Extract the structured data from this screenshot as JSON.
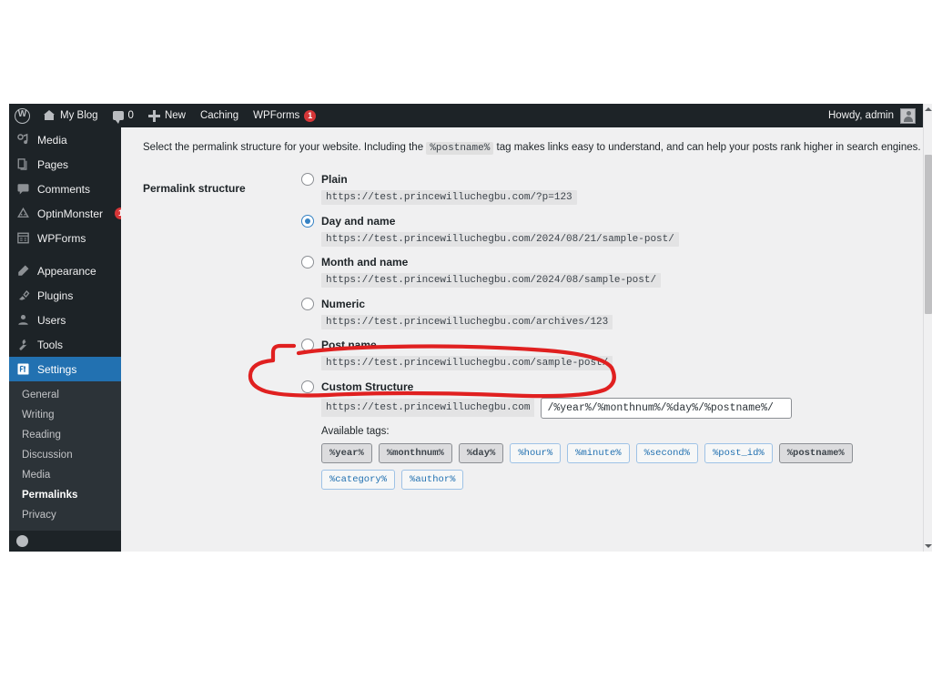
{
  "adminbar": {
    "wp_logo": "wordpress-logo",
    "site_name": "My Blog",
    "comments_count": "0",
    "new_label": "New",
    "caching_label": "Caching",
    "wpforms_label": "WPForms",
    "wpforms_badge": "1",
    "howdy": "Howdy, admin"
  },
  "sidebar": {
    "items": [
      {
        "label": "Media",
        "icon": "media-icon",
        "badge": ""
      },
      {
        "label": "Pages",
        "icon": "pages-icon",
        "badge": ""
      },
      {
        "label": "Comments",
        "icon": "comments-icon",
        "badge": ""
      },
      {
        "label": "OptinMonster",
        "icon": "optinmonster-icon",
        "badge": "1"
      },
      {
        "label": "WPForms",
        "icon": "wpforms-icon",
        "badge": ""
      },
      {
        "label": "Appearance",
        "icon": "appearance-icon",
        "badge": ""
      },
      {
        "label": "Plugins",
        "icon": "plugins-icon",
        "badge": ""
      },
      {
        "label": "Users",
        "icon": "users-icon",
        "badge": ""
      },
      {
        "label": "Tools",
        "icon": "tools-icon",
        "badge": ""
      },
      {
        "label": "Settings",
        "icon": "settings-icon",
        "badge": ""
      }
    ],
    "submenu": [
      {
        "label": "General"
      },
      {
        "label": "Writing"
      },
      {
        "label": "Reading"
      },
      {
        "label": "Discussion"
      },
      {
        "label": "Media"
      },
      {
        "label": "Permalinks"
      },
      {
        "label": "Privacy"
      }
    ],
    "active_item": "Settings",
    "active_subitem": "Permalinks"
  },
  "main": {
    "intro_before": "Select the permalink structure for your website. Including the",
    "intro_tag": "%postname%",
    "intro_after": "tag makes links easy to understand, and can help your posts rank higher in search engines.",
    "row_label": "Permalink structure",
    "options": [
      {
        "label": "Plain",
        "example": "https://test.princewilluchegbu.com/?p=123",
        "selected": false
      },
      {
        "label": "Day and name",
        "example": "https://test.princewilluchegbu.com/2024/08/21/sample-post/",
        "selected": true
      },
      {
        "label": "Month and name",
        "example": "https://test.princewilluchegbu.com/2024/08/sample-post/",
        "selected": false
      },
      {
        "label": "Numeric",
        "example": "https://test.princewilluchegbu.com/archives/123",
        "selected": false
      },
      {
        "label": "Post name",
        "example": "https://test.princewilluchegbu.com/sample-post/",
        "selected": false
      }
    ],
    "custom": {
      "label": "Custom Structure",
      "selected": false,
      "prefix": "https://test.princewilluchegbu.com",
      "value": "/%year%/%monthnum%/%day%/%postname%/"
    },
    "available_tags_label": "Available tags:",
    "tags": [
      {
        "label": "%year%",
        "used": true
      },
      {
        "label": "%monthnum%",
        "used": true
      },
      {
        "label": "%day%",
        "used": true
      },
      {
        "label": "%hour%",
        "used": false
      },
      {
        "label": "%minute%",
        "used": false
      },
      {
        "label": "%second%",
        "used": false
      },
      {
        "label": "%post_id%",
        "used": false
      },
      {
        "label": "%postname%",
        "used": true
      },
      {
        "label": "%category%",
        "used": false
      },
      {
        "label": "%author%",
        "used": false
      }
    ]
  },
  "annotation": {
    "shape": "hand-drawn-ellipse",
    "color": "#e02020",
    "target": "Post name"
  },
  "colors": {
    "admin_dark": "#1d2327",
    "submenu_dark": "#2c3338",
    "accent_blue": "#2271b1",
    "radio_blue": "#3582c4",
    "badge_red": "#d63638",
    "page_bg": "#f0f0f1",
    "annotation_red": "#e02020"
  }
}
